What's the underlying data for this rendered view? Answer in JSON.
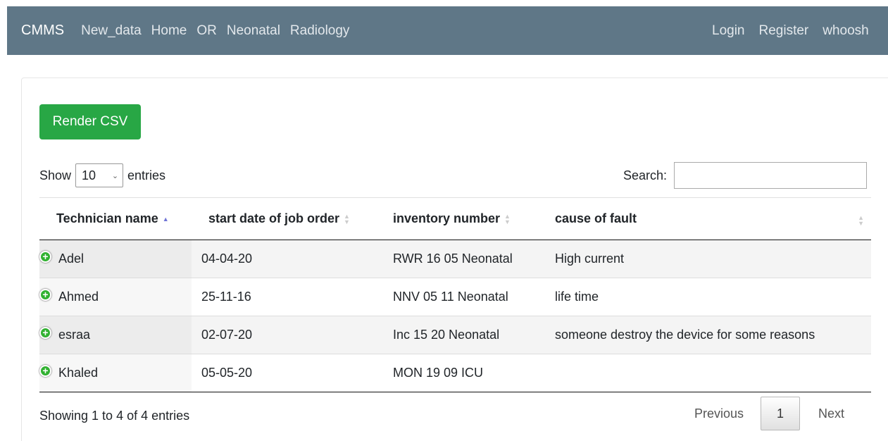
{
  "nav": {
    "brand": "CMMS",
    "links": [
      "New_data",
      "Home",
      "OR",
      "Neonatal",
      "Radiology"
    ],
    "right": [
      "Login",
      "Register",
      "whoosh"
    ]
  },
  "render_csv_label": "Render CSV",
  "length": {
    "show": "Show",
    "value": "10",
    "entries": "entries"
  },
  "search": {
    "label": "Search:",
    "value": ""
  },
  "table": {
    "headers": [
      "Technician name",
      "start date of job order",
      "inventory number",
      "cause of fault"
    ],
    "rows": [
      [
        "Adel",
        "04-04-20",
        "RWR 16 05 Neonatal",
        "High current"
      ],
      [
        "Ahmed",
        "25-11-16",
        "NNV 05 11 Neonatal",
        "life time"
      ],
      [
        "esraa",
        "02-07-20",
        "Inc 15 20 Neonatal",
        "someone destroy the device for some reasons"
      ],
      [
        "Khaled",
        "05-05-20",
        "MON 19 09 ICU",
        ""
      ]
    ]
  },
  "info": "Showing 1 to 4 of 4 entries",
  "pagination": {
    "previous": "Previous",
    "current": "1",
    "next": "Next"
  },
  "colors": {
    "navbar": "#5f7787",
    "button": "#28a745",
    "row_icon": "#31b131"
  }
}
